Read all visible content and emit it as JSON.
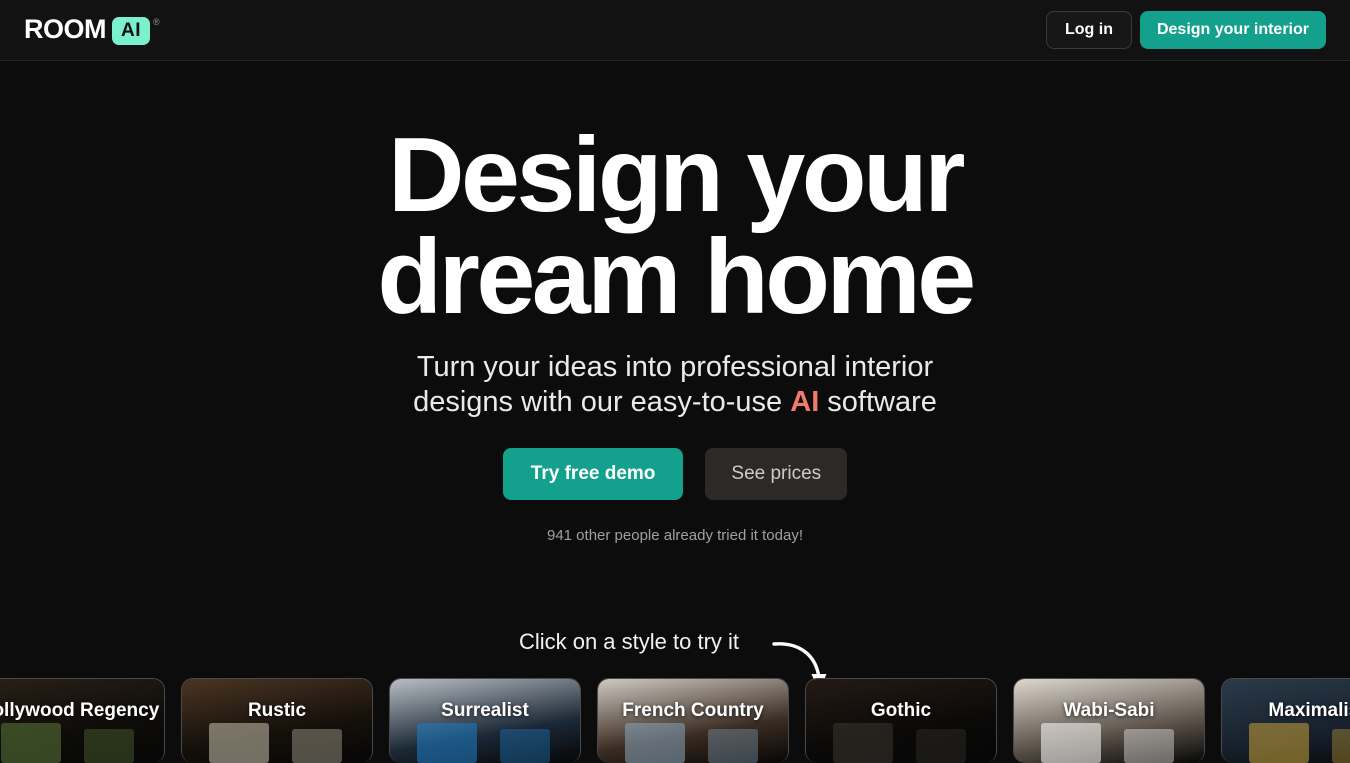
{
  "header": {
    "logo": {
      "word": "ROOM",
      "badge": "AI",
      "registered": "®"
    },
    "login_label": "Log in",
    "design_label": "Design your interior"
  },
  "hero": {
    "title_line1": "Design your",
    "title_line2": "dream home",
    "sub_part1": "Turn your ideas into professional interior designs with our easy-to-use ",
    "sub_accent": "AI",
    "sub_part2": " software",
    "sub_line1": "Turn your ideas into professional interior",
    "sub_line2_pre": "designs with our easy-to-use ",
    "sub_line2_accent": "AI",
    "sub_line2_post": " software",
    "cta_primary": "Try free demo",
    "cta_secondary": "See prices",
    "social_proof": "941 other people already tried it today!"
  },
  "styles_section": {
    "hint": "Click on a style to try it",
    "arrow_icon": "curved-down-right-arrow-icon",
    "cards": [
      {
        "label": "Hollywood Regency",
        "tone_a": "#2a2018",
        "tone_b": "#0d0c09",
        "accent": "#5c7a3a"
      },
      {
        "label": "Rustic",
        "tone_a": "#4a3524",
        "tone_b": "#140f0a",
        "accent": "#c9c2ad"
      },
      {
        "label": "Surrealist",
        "tone_a": "#b9bec4",
        "tone_b": "#1b2836",
        "accent": "#1f7ec4"
      },
      {
        "label": "French Country",
        "tone_a": "#cfc9c2",
        "tone_b": "#3a2c22",
        "accent": "#8aa5bd"
      },
      {
        "label": "Gothic",
        "tone_a": "#241a14",
        "tone_b": "#0a0908",
        "accent": "#3a3630"
      },
      {
        "label": "Wabi-Sabi",
        "tone_a": "#ddd7ce",
        "tone_b": "#5a5148",
        "accent": "#ffffff"
      },
      {
        "label": "Maximalist",
        "tone_a": "#2b3a4a",
        "tone_b": "#16202b",
        "accent": "#c9a23a"
      }
    ]
  },
  "colors": {
    "background": "#0c0c0c",
    "header_bg": "#121212",
    "teal": "#13a08c",
    "mint": "#7af0cd",
    "accent_coral": "#f07a6e",
    "muted_text": "#a0a0a0"
  }
}
